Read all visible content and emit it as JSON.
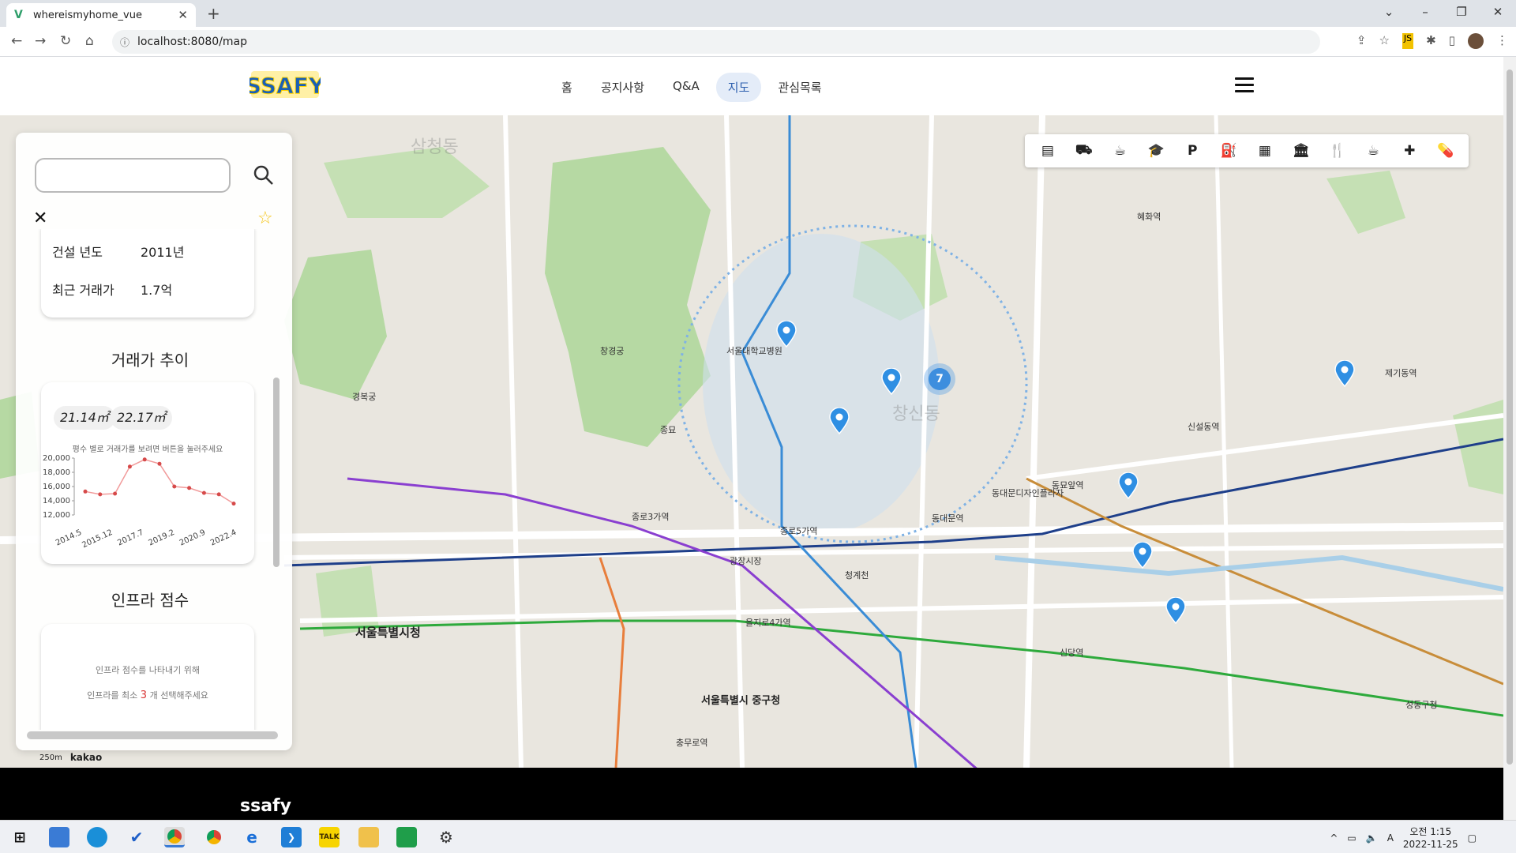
{
  "browser": {
    "tab_title": "whereismyhome_vue",
    "url": "localhost:8080/map"
  },
  "site": {
    "logo_text": "SSAFY",
    "nav": [
      {
        "label": "홈"
      },
      {
        "label": "공지사항"
      },
      {
        "label": "Q&A"
      },
      {
        "label": "지도",
        "active": true
      },
      {
        "label": "관심목록"
      }
    ]
  },
  "map": {
    "labels": {
      "samcheong": "삼청동",
      "city_hall": "서울특별시청",
      "jung_gu": "서울특별시 중구청",
      "jongno3": "종로3가역",
      "dongdaemun": "동대문역",
      "euljiro4": "을지로4가역",
      "dongmyo": "동묘앞역",
      "sindang": "신당역",
      "seongdong": "성동구청",
      "hyehwa": "혜화역",
      "sinseol": "신설동역",
      "jegi": "제기동역",
      "chungmuro": "충무로역",
      "jongno5": "종로5가역",
      "gyeongbok": "경복궁",
      "changgyeong": "창경궁",
      "jongmyo": "종묘",
      "seoul_univ_hospital": "서울대학교병원",
      "gwangjang": "광장시장",
      "sungshin": "창신동",
      "ddp": "동대문디자인플라자",
      "cheonggye": "청계천",
      "scale": "250m",
      "kakao": "kakao"
    },
    "cluster_count": "7",
    "category_icons": [
      "store-icon",
      "car-icon",
      "coffee-icon",
      "school-icon",
      "parking-icon",
      "gas-station-icon",
      "subway-icon",
      "bank-icon",
      "restaurant-icon",
      "cafe-icon",
      "hospital-icon",
      "pharmacy-icon"
    ],
    "category_glyphs": [
      "▤",
      "⛟",
      "☕",
      "🎓",
      "P",
      "⛽",
      "▦",
      "🏛",
      "🍴",
      "☕",
      "✚",
      "💊"
    ]
  },
  "panel": {
    "search": {
      "placeholder": "",
      "value": ""
    },
    "info": {
      "build_year_label": "건설 년도",
      "build_year_value": "2011년",
      "recent_price_label": "최근 거래가",
      "recent_price_value": "1.7억"
    },
    "trend_title": "거래가 추이",
    "area_chips": [
      "21.14㎡",
      "22.17㎡"
    ],
    "chart_hint": "평수 별로 거래가를 보려면 버튼을 눌러주세요",
    "infra_title": "인프라 점수",
    "infra_text_1": "인프라 점수를 나타내기 위해",
    "infra_text_2_pre": "인프라를 최소",
    "infra_text_2_num": "3",
    "infra_text_2_post": "개 선택해주세요"
  },
  "chart_data": {
    "type": "line",
    "x": [
      "2014.5",
      "2014.9",
      "2015.12",
      "2016.6",
      "2017.7",
      "2017.10",
      "2019.2",
      "2020.9",
      "2020.11",
      "2021.3",
      "2022.4"
    ],
    "tick_labels": [
      "2014.5",
      "2015.12",
      "2017.7",
      "2019.2",
      "2020.9",
      "2022.4"
    ],
    "values": [
      15300,
      14900,
      15000,
      18800,
      19800,
      19200,
      16000,
      15800,
      15100,
      14900,
      13600
    ],
    "ylim": [
      12000,
      20000
    ],
    "yticks": [
      "20,000",
      "18,000",
      "16,000",
      "14,000",
      "12,000"
    ],
    "line_color": "#f19a9a",
    "point_color": "#d64a4a"
  },
  "footer": {
    "text": "ssafy"
  },
  "taskbar": {
    "time": "오전 1:15",
    "date": "2022-11-25"
  },
  "colors": {
    "map_bg": "#e9e6df",
    "park": "#b6d9a3",
    "road_major": "#ffffff",
    "line2": "#2eaa3c",
    "line4": "#3a8cd6",
    "line1": "#1e3f8a",
    "line5": "#8a3fd0",
    "pin": "#2f8fe3"
  }
}
